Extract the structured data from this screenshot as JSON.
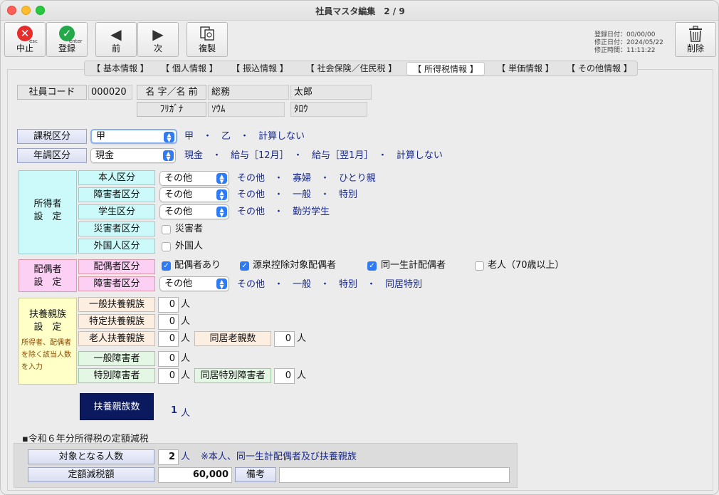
{
  "window": {
    "title": "社員マスタ編集　2 / 9"
  },
  "toolbar": {
    "cancel": {
      "label": "中止",
      "sub": "esc"
    },
    "save": {
      "label": "登録",
      "sub": "enter"
    },
    "prev": {
      "label": "前"
    },
    "next": {
      "label": "次"
    },
    "copy": {
      "label": "複製"
    },
    "delete": {
      "label": "削除"
    }
  },
  "meta": {
    "registered": "登録日付：00/00/00",
    "modified_date": "修正日付：2024/05/22",
    "modified_time": "修正時間：11:11:22"
  },
  "tabs": [
    "【 基本情報 】",
    "【 個人情報 】",
    "【 振込情報 】",
    "【 社会保険／住民税 】",
    "【 所得税情報 】",
    "【 単価情報 】",
    "【 その他情報 】"
  ],
  "employee": {
    "code_label": "社員コード",
    "code": "000020",
    "name_label": "名 字／名 前",
    "last_name": "総務",
    "first_name": "太郎",
    "kana_label": "ﾌﾘｶﾞﾅ",
    "last_kana": "ｿｳﾑ",
    "first_kana": "ﾀﾛｳ"
  },
  "tax": {
    "category_label": "課税区分",
    "category_value": "甲",
    "category_options": "甲　・　乙　・　計算しない",
    "adjust_label": "年調区分",
    "adjust_value": "現金",
    "adjust_options": "現金　・　給与［12月］　・　給与［翌1月］　・　計算しない"
  },
  "earner": {
    "group_label_1": "所得者",
    "group_label_2": "設　定",
    "self_label": "本人区分",
    "self_value": "その他",
    "self_options": "その他　・　寡婦　・　ひとり親",
    "disabled_label": "障害者区分",
    "disabled_value": "その他",
    "disabled_options": "その他　・　一般　・　特別",
    "student_label": "学生区分",
    "student_value": "その他",
    "student_options": "その他　・　勤労学生",
    "disaster_label": "災害者区分",
    "disaster_check": "災害者",
    "foreign_label": "外国人区分",
    "foreign_check": "外国人"
  },
  "spouse": {
    "group_label_1": "配偶者",
    "group_label_2": "設　定",
    "spouse_label": "配偶者区分",
    "checks": [
      {
        "label": "配偶者あり",
        "checked": true
      },
      {
        "label": "源泉控除対象配偶者",
        "checked": true
      },
      {
        "label": "同一生計配偶者",
        "checked": true
      },
      {
        "label": "老人（70歳以上）",
        "checked": false
      }
    ],
    "disabled_label": "障害者区分",
    "disabled_value": "その他",
    "disabled_options": "その他　・　一般　・　特別　・　同居特別"
  },
  "dependents": {
    "group_label_1": "扶養親族",
    "group_label_2": "設　定",
    "note": "所得者、配偶者を除く該当人数を入力",
    "general_label": "一般扶養親族",
    "general_value": "0",
    "specific_label": "特定扶養親族",
    "specific_value": "0",
    "elderly_label": "老人扶養親族",
    "elderly_value": "0",
    "cohabit_elderly_label": "同居老親数",
    "cohabit_elderly_value": "0",
    "general_disabled_label": "一般障害者",
    "general_disabled_value": "0",
    "special_disabled_label": "特別障害者",
    "special_disabled_value": "0",
    "cohabit_special_label": "同居特別障害者",
    "cohabit_special_value": "0",
    "unit": "人",
    "count_button": "扶養親族数",
    "count_value": "1",
    "count_unit": "人"
  },
  "reduction": {
    "section_title": "▪令和６年分所得税の定額減税",
    "target_label": "対象となる人数",
    "target_value": "2",
    "target_unit": "人",
    "target_note": "※本人、同一生計配偶者及び扶養親族",
    "amount_label": "定額減税額",
    "amount_value": "60,000",
    "memo_label": "備考",
    "memo_value": ""
  }
}
